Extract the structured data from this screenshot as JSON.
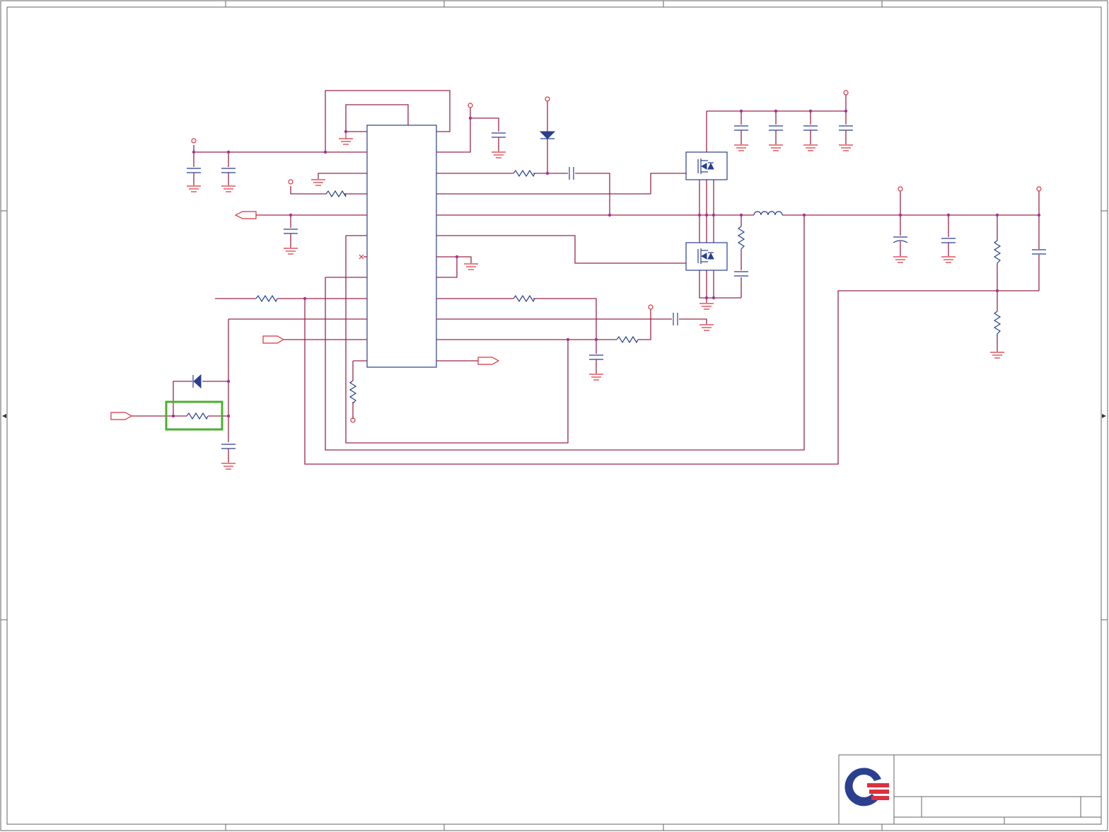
{
  "sheet": {
    "background": "#ffffff",
    "border_color": "#666666",
    "wire_color": "#9a2748",
    "part_color": "#2a3f8f",
    "power_color": "#d9323e",
    "junction_color": "#a0339a"
  },
  "highlight": {
    "target": "input-series-resistor",
    "color": "#4caf30"
  },
  "title_block": {
    "logo": "company-logo-icon",
    "logo_colors": [
      "#2a3f8f",
      "#d9323e"
    ]
  }
}
